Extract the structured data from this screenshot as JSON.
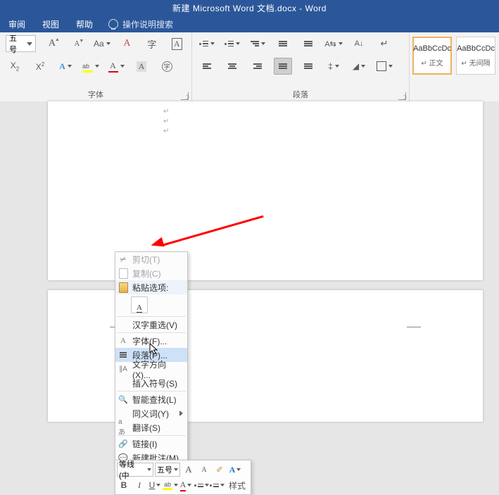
{
  "title": {
    "doc": "新建 Microsoft Word 文档.docx",
    "sep": " - ",
    "app": "Word"
  },
  "menu": {
    "review": "审阅",
    "view": "视图",
    "help": "帮助",
    "search_placeholder": "操作说明搜索"
  },
  "font_group": {
    "label": "字体",
    "size_select": "五号",
    "grow": "A",
    "grow_sup": "▲",
    "shrink": "A",
    "shrink_sup": "▼",
    "case": "Aa",
    "clear": "A",
    "phonetic": "㉆",
    "charborder": "A",
    "sub": "X",
    "sub2": "2",
    "sup_x": "X",
    "sup2": "2",
    "A_effects": "A",
    "hilite": "ab",
    "fontcolor": "A",
    "charshade": "A",
    "enclose": "㊕"
  },
  "para_group": {
    "label": "段落"
  },
  "styles": {
    "preview": "AaBbCcDc",
    "normal": "正文",
    "nospacing": "无间隔"
  },
  "context_menu": {
    "cut": "剪切(T)",
    "copy": "复制(C)",
    "paste_header": "粘贴选项:",
    "reconvert": "汉字重选(V)",
    "font": "字体(F)...",
    "paragraph": "段落(P)...",
    "textdir": "文字方向(X)...",
    "symbol": "插入符号(S)",
    "smartlookup": "智能查找(L)",
    "synonyms": "同义词(Y)",
    "translate": "翻译(S)",
    "link": "链接(I)",
    "newcomment": "新建批注(M)"
  },
  "mini_toolbar": {
    "font_name": "等线 (中",
    "font_size": "五号",
    "styles_label": "样式",
    "A_big": "A",
    "A_small": "A",
    "B": "B",
    "I": "I",
    "U": "U",
    "A_color": "A"
  }
}
